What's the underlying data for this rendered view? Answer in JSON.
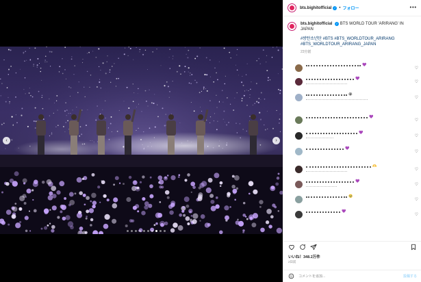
{
  "header": {
    "username": "bts.bighitofficial",
    "follow_label": "フォロー",
    "more_glyph": "•••",
    "verified_glyph": "✓",
    "separator": "•"
  },
  "caption": {
    "username": "bts.bighitofficial",
    "text": "BTS WORLD TOUR 'ARIRANG' IN JAPAN",
    "tags_line1": "#방탄소년단 #BTS #BTS_WORLDTOUR_ARIRANG",
    "tags_line2": "#BTS_WORLDTOUR_ARIRANG_JAPAN",
    "time": "23分前"
  },
  "media": {
    "prev_glyph": "‹",
    "next_glyph": "›",
    "carousel_count": 10,
    "carousel_active_index": 7
  },
  "comments": {
    "avatar_colors": [
      "#8a6a4a",
      "#5a2a3a",
      "#9fb0c8",
      "#6a7a5a",
      "#2a2a2a",
      "#a0b8c8",
      "#3a2a2a",
      "#7a5a5a",
      "#8aa0a0",
      "#3a3a3a"
    ],
    "emojis": [
      "💜",
      "💜",
      "😭",
      "💜",
      "💜",
      "💜",
      "🫶",
      "💜",
      "🥹",
      "💜"
    ],
    "heart_glyph": "♡"
  },
  "actions": {
    "like_icon": "heart-icon",
    "comment_icon": "comment-icon",
    "share_icon": "share-icon",
    "save_icon": "bookmark-icon"
  },
  "likes_text": "いいね！348.2万件",
  "ago_text": "2日前",
  "composer": {
    "placeholder": "コメントを追加...",
    "post_label": "投稿する",
    "emoji_icon": "emoji-icon"
  },
  "colors": {
    "accent": "#0095f6",
    "stage_purple": "#3a2f66",
    "lightstick": "#c9a6ff"
  }
}
